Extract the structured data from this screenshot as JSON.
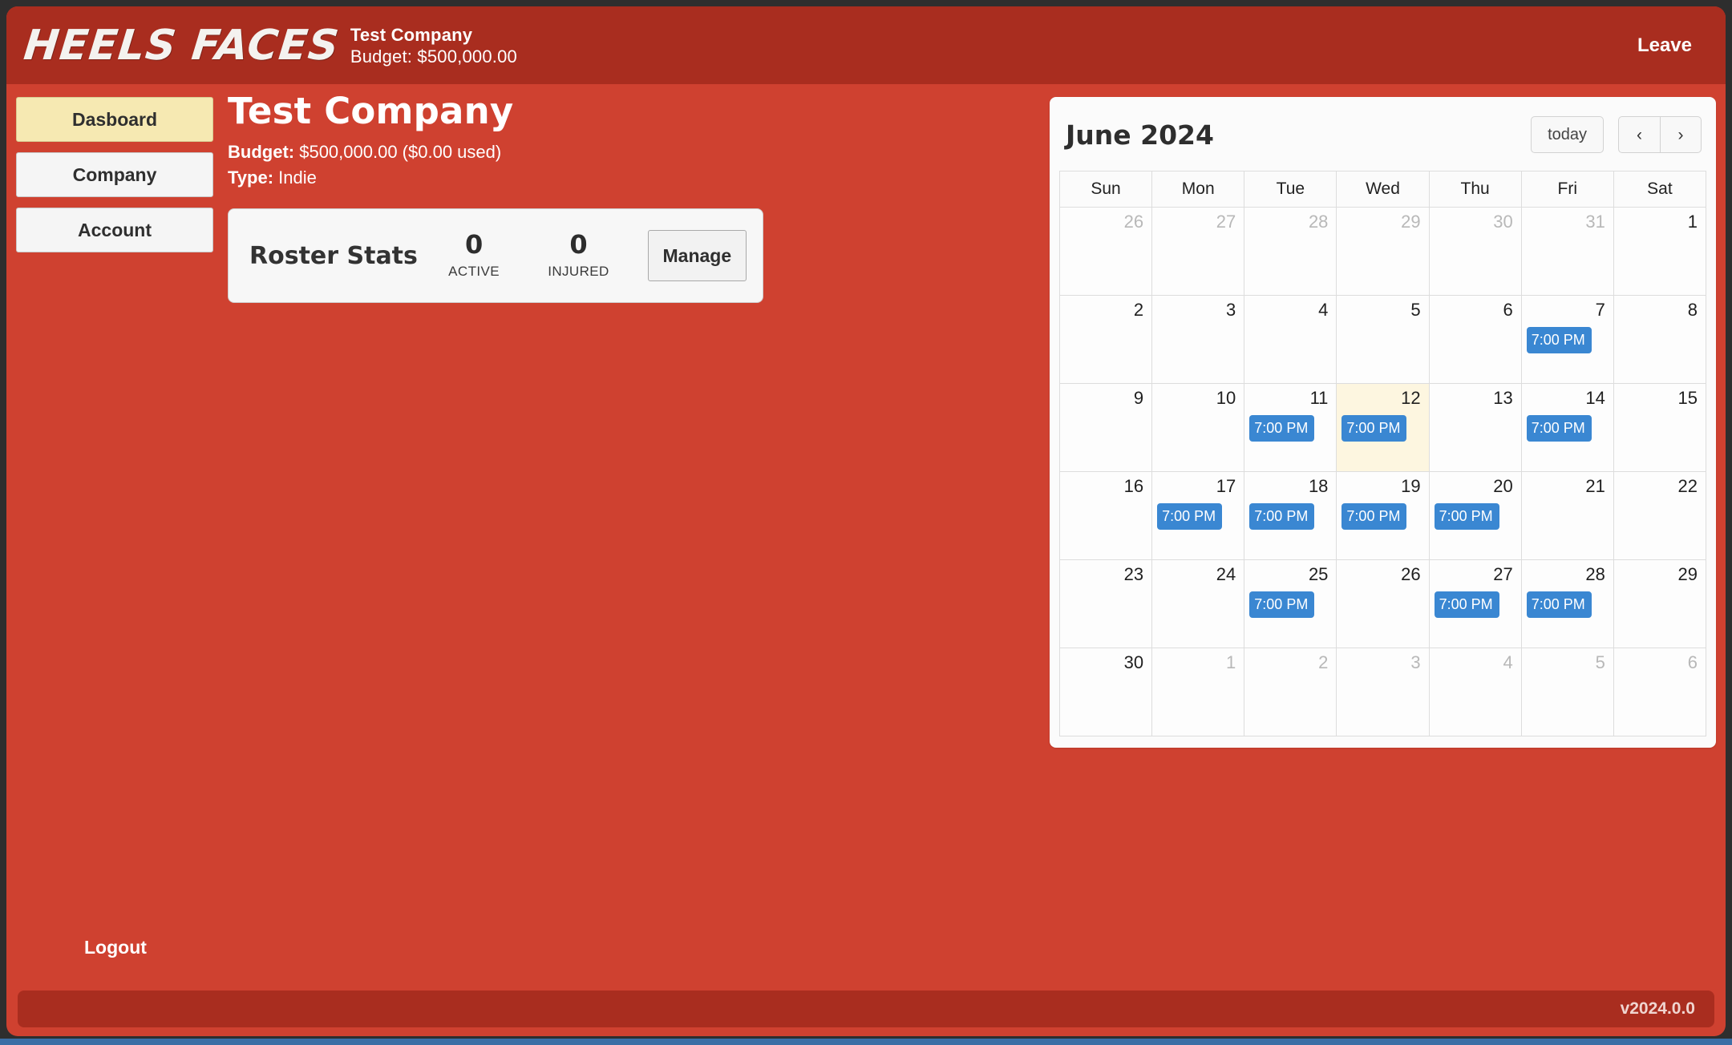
{
  "topbar": {
    "logo": "HEELS FACES",
    "company_name": "Test Company",
    "budget_line": "Budget: $500,000.00",
    "leave_label": "Leave"
  },
  "sidebar": {
    "items": [
      {
        "label": "Dasboard",
        "active": true
      },
      {
        "label": "Company",
        "active": false
      },
      {
        "label": "Account",
        "active": false
      }
    ],
    "logout_label": "Logout"
  },
  "main": {
    "title": "Test Company",
    "budget_label": "Budget:",
    "budget_value": "$500,000.00 ($0.00 used)",
    "type_label": "Type:",
    "type_value": "Indie",
    "roster": {
      "title": "Roster Stats",
      "stats": [
        {
          "value": "0",
          "label": "ACTIVE"
        },
        {
          "value": "0",
          "label": "INJURED"
        }
      ],
      "manage_label": "Manage"
    }
  },
  "calendar": {
    "title": "June 2024",
    "today_label": "today",
    "prev_icon": "chevron-left",
    "next_icon": "chevron-right",
    "prev_glyph": "‹",
    "next_glyph": "›",
    "weekdays": [
      "Sun",
      "Mon",
      "Tue",
      "Wed",
      "Thu",
      "Fri",
      "Sat"
    ],
    "event_time": "7:00 PM",
    "today_date": 12,
    "weeks": [
      [
        {
          "day": "26",
          "other": true,
          "events": []
        },
        {
          "day": "27",
          "other": true,
          "events": []
        },
        {
          "day": "28",
          "other": true,
          "events": []
        },
        {
          "day": "29",
          "other": true,
          "events": []
        },
        {
          "day": "30",
          "other": true,
          "events": []
        },
        {
          "day": "31",
          "other": true,
          "events": []
        },
        {
          "day": "1",
          "other": false,
          "events": []
        }
      ],
      [
        {
          "day": "2",
          "other": false,
          "events": []
        },
        {
          "day": "3",
          "other": false,
          "events": []
        },
        {
          "day": "4",
          "other": false,
          "events": []
        },
        {
          "day": "5",
          "other": false,
          "events": []
        },
        {
          "day": "6",
          "other": false,
          "events": []
        },
        {
          "day": "7",
          "other": false,
          "events": [
            "7:00 PM"
          ]
        },
        {
          "day": "8",
          "other": false,
          "events": []
        }
      ],
      [
        {
          "day": "9",
          "other": false,
          "events": []
        },
        {
          "day": "10",
          "other": false,
          "events": []
        },
        {
          "day": "11",
          "other": false,
          "events": [
            "7:00 PM"
          ]
        },
        {
          "day": "12",
          "other": false,
          "events": [
            "7:00 PM"
          ],
          "today": true
        },
        {
          "day": "13",
          "other": false,
          "events": []
        },
        {
          "day": "14",
          "other": false,
          "events": [
            "7:00 PM"
          ]
        },
        {
          "day": "15",
          "other": false,
          "events": []
        }
      ],
      [
        {
          "day": "16",
          "other": false,
          "events": []
        },
        {
          "day": "17",
          "other": false,
          "events": [
            "7:00 PM"
          ]
        },
        {
          "day": "18",
          "other": false,
          "events": [
            "7:00 PM"
          ]
        },
        {
          "day": "19",
          "other": false,
          "events": [
            "7:00 PM"
          ]
        },
        {
          "day": "20",
          "other": false,
          "events": [
            "7:00 PM"
          ]
        },
        {
          "day": "21",
          "other": false,
          "events": []
        },
        {
          "day": "22",
          "other": false,
          "events": []
        }
      ],
      [
        {
          "day": "23",
          "other": false,
          "events": []
        },
        {
          "day": "24",
          "other": false,
          "events": []
        },
        {
          "day": "25",
          "other": false,
          "events": [
            "7:00 PM"
          ]
        },
        {
          "day": "26",
          "other": false,
          "events": []
        },
        {
          "day": "27",
          "other": false,
          "events": [
            "7:00 PM"
          ]
        },
        {
          "day": "28",
          "other": false,
          "events": [
            "7:00 PM"
          ]
        },
        {
          "day": "29",
          "other": false,
          "events": []
        }
      ],
      [
        {
          "day": "30",
          "other": false,
          "events": []
        },
        {
          "day": "1",
          "other": true,
          "events": []
        },
        {
          "day": "2",
          "other": true,
          "events": []
        },
        {
          "day": "3",
          "other": true,
          "events": []
        },
        {
          "day": "4",
          "other": true,
          "events": []
        },
        {
          "day": "5",
          "other": true,
          "events": []
        },
        {
          "day": "6",
          "other": true,
          "events": []
        }
      ]
    ]
  },
  "footer": {
    "version": "v2024.0.0"
  },
  "colors": {
    "brand_red": "#cf4130",
    "brand_dark_red": "#a92d1f",
    "event_blue": "#3a87d2",
    "active_nav": "#f6e9b2",
    "today_cell": "#fdf6e0"
  }
}
